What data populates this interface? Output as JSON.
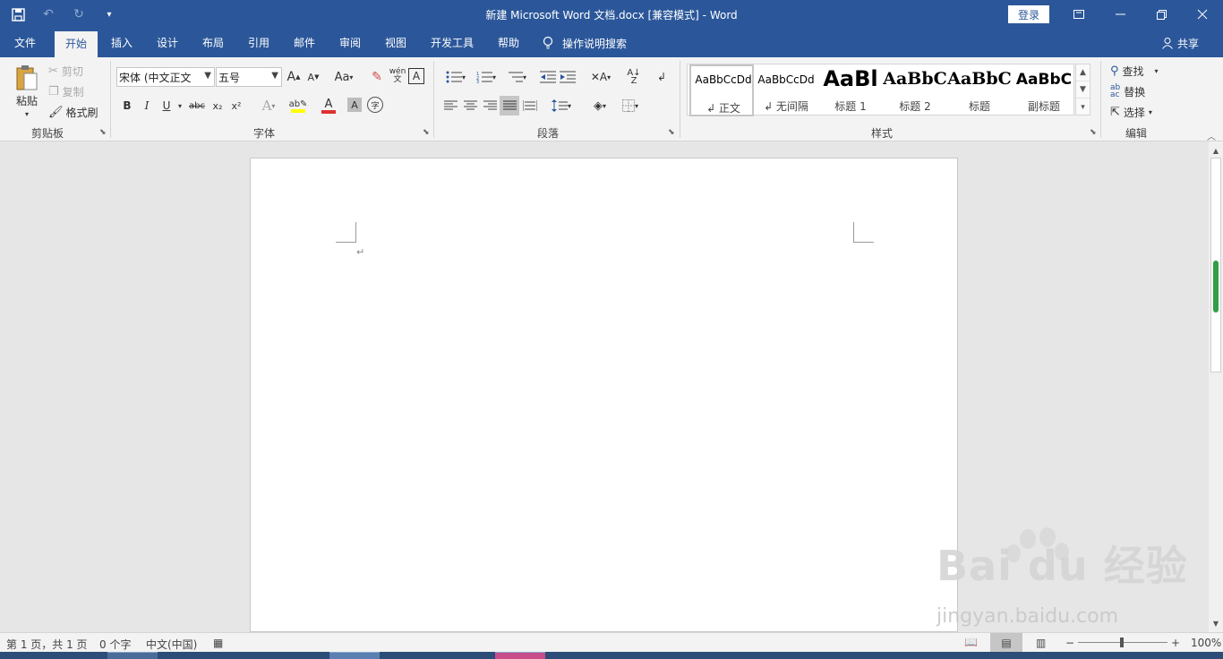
{
  "titlebar": {
    "title": "新建 Microsoft Word 文档.docx [兼容模式]  -  Word",
    "login": "登录",
    "qat": {
      "save": "save-icon",
      "undo": "undo-icon",
      "redo": "redo-icon",
      "customize": "dropdown-icon"
    }
  },
  "tabs": [
    "文件",
    "开始",
    "插入",
    "设计",
    "布局",
    "引用",
    "邮件",
    "审阅",
    "视图",
    "开发工具",
    "帮助"
  ],
  "tellme": "操作说明搜索",
  "share": "共享",
  "clipboard": {
    "paste": "粘贴",
    "cut": "剪切",
    "copy": "复制",
    "format_painter": "格式刷",
    "label": "剪贴板"
  },
  "font": {
    "name": "宋体 (中文正文",
    "size": "五号",
    "label": "字体",
    "bold": "B",
    "italic": "I",
    "underline": "U",
    "strike": "abc",
    "sub": "x₂",
    "sup": "x²",
    "case": "Aa",
    "grow": "A",
    "shrink": "A",
    "phonetic": "wén",
    "border": "A",
    "effects": "A",
    "color": "A",
    "shade": "A",
    "encircle": "字"
  },
  "paragraph": {
    "label": "段落"
  },
  "styles": {
    "label": "样式",
    "items": [
      {
        "preview": "AaBbCcDd",
        "name": "↲ 正文"
      },
      {
        "preview": "AaBbCcDd",
        "name": "↲ 无间隔"
      },
      {
        "preview": "AaBl",
        "name": "标题 1"
      },
      {
        "preview": "AaBbC",
        "name": "标题 2"
      },
      {
        "preview": "AaBbC",
        "name": "标题"
      },
      {
        "preview": "AaBbC",
        "name": "副标题"
      }
    ]
  },
  "editing": {
    "find": "查找",
    "replace": "替换",
    "select": "选择",
    "label": "编辑"
  },
  "document": {
    "paragraph_mark": "↵"
  },
  "statusbar": {
    "page": "第 1 页，共 1 页",
    "words": "0 个字",
    "language": "中文(中国)",
    "zoom": "100%"
  },
  "watermark": {
    "logo": "Bai  du 经验",
    "url": "jingyan.baidu.com"
  },
  "colors": {
    "accent": "#2b579a",
    "ribbon": "#f3f3f3",
    "canvas": "#e6e6e6"
  }
}
